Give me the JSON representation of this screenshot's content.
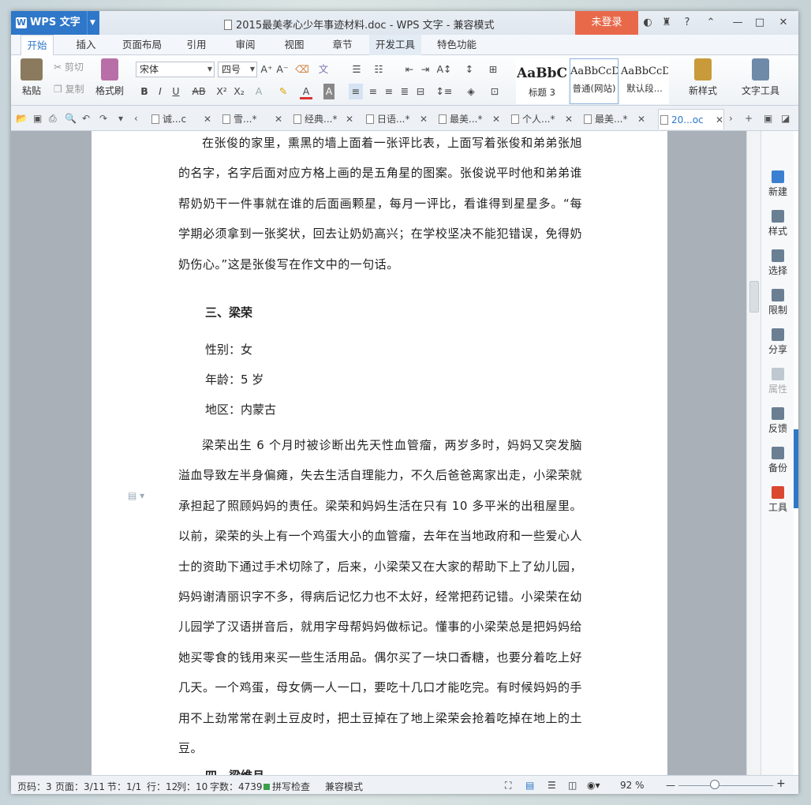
{
  "window": {
    "app_name": "WPS 文字",
    "title": "2015最美孝心少年事迹材料.doc - WPS 文字 - 兼容模式",
    "login_label": "未登录"
  },
  "ribbon_tabs": [
    "开始",
    "插入",
    "页面布局",
    "引用",
    "审阅",
    "视图",
    "章节",
    "开发工具",
    "特色功能"
  ],
  "ribbon": {
    "paste": "粘贴",
    "cut": "剪切",
    "copy": "复制",
    "format_painter": "格式刷",
    "font_name": "宋体",
    "font_size": "四号",
    "styles": [
      {
        "preview": "AaBbC",
        "label": "标题 3"
      },
      {
        "preview": "AaBbCcD",
        "label": "普通(网站)"
      },
      {
        "preview": "AaBbCcDd",
        "label": "默认段..."
      }
    ],
    "new_style": "新样式",
    "text_tools": "文字工具"
  },
  "doc_tabs": [
    "诚...c",
    "雪...*",
    "经典...*",
    "日语...*",
    "最美...*",
    "个人...*",
    "最美...*",
    "20...oc"
  ],
  "document": {
    "para1": "在张俊的家里，熏黑的墙上面着一张评比表，上面写着张俊和弟弟张旭的名字，名字后面对应方格上画的是五角星的图案。张俊说平时他和弟弟谁帮奶奶干一件事就在谁的后面画颗星，每月一评比，看谁得到星星多。“每学期必须拿到一张奖状，回去让奶奶高兴；在学校坚决不能犯错误，免得奶奶伤心。”这是张俊写在作文中的一句话。",
    "heading": "三、梁荣",
    "gender": "性别：女",
    "age": "年龄：5 岁",
    "region": "地区：内蒙古",
    "para2": "梁荣出生 6 个月时被诊断出先天性血管瘤，两岁多时，妈妈又突发脑溢血导致左半身偏瘫，失去生活自理能力，不久后爸爸离家出走，小梁荣就承担起了照顾妈妈的责任。梁荣和妈妈生活在只有 10 多平米的出租屋里。以前，梁荣的头上有一个鸡蛋大小的血管瘤，去年在当地政府和一些爱心人士的资助下通过手术切除了，后来，小梁荣又在大家的帮助下上了幼儿园，妈妈谢清丽识字不多，得病后记忆力也不太好，经常把药记错。小梁荣在幼儿园学了汉语拼音后，就用字母帮妈妈做标记。懂事的小梁荣总是把妈妈给她买零食的钱用来买一些生活用品。偶尔买了一块口香糖，也要分着吃上好几天。一个鸡蛋，母女俩一人一口，要吃十几口才能吃完。有时候妈妈的手用不上劲常常在剥土豆皮时，把土豆掉在了地上梁荣会抢着吃掉在地上的土豆。",
    "next_heading": "四、梁维月"
  },
  "side_panel": [
    "新建",
    "样式",
    "选择",
    "限制",
    "分享",
    "属性",
    "反馈",
    "备份",
    "工具"
  ],
  "status": {
    "page_code": "页码：3",
    "pages": "页面：3/11",
    "section": "节：1/1",
    "row": "行：12",
    "col": "列：10",
    "words": "字数：4739",
    "spell": "拼写检查",
    "compat": "兼容模式",
    "zoom": "92 %"
  },
  "colors": {
    "accent": "#2e77c9",
    "login": "#e8694a"
  }
}
